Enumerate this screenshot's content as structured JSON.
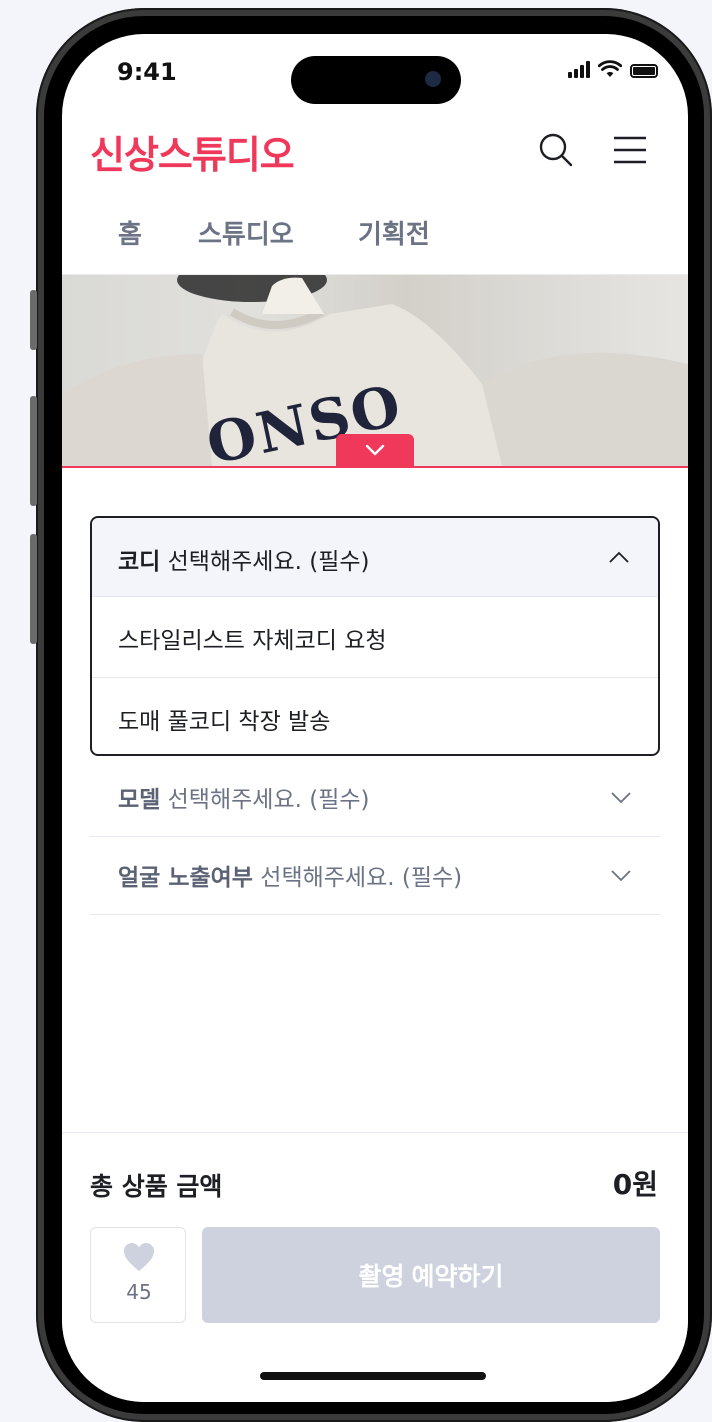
{
  "status_bar": {
    "time": "9:41"
  },
  "header": {
    "logo": "신상스튜디오",
    "search_icon": "search-icon",
    "menu_icon": "hamburger-menu-icon"
  },
  "nav": {
    "items": [
      "홈",
      "스튜디오",
      "기획전"
    ]
  },
  "options": {
    "coordi": {
      "title": "코디",
      "prompt": "선택해주세요. (필수)",
      "expanded": true,
      "choices": [
        "스타일리스트 자체코디 요청",
        "도매 풀코디 착장 발송"
      ]
    },
    "model": {
      "title": "모델",
      "prompt": "선택해주세요. (필수)"
    },
    "face": {
      "title": "얼굴 노출여부",
      "prompt": "선택해주세요. (필수)"
    }
  },
  "summary": {
    "total_label": "총 상품 금액",
    "total_value": "0원"
  },
  "actions": {
    "like_count": "45",
    "reserve_label": "촬영 예약하기"
  },
  "colors": {
    "accent": "#f0385a",
    "disabled_button": "#cdd2de",
    "text_muted": "#6b7384"
  }
}
